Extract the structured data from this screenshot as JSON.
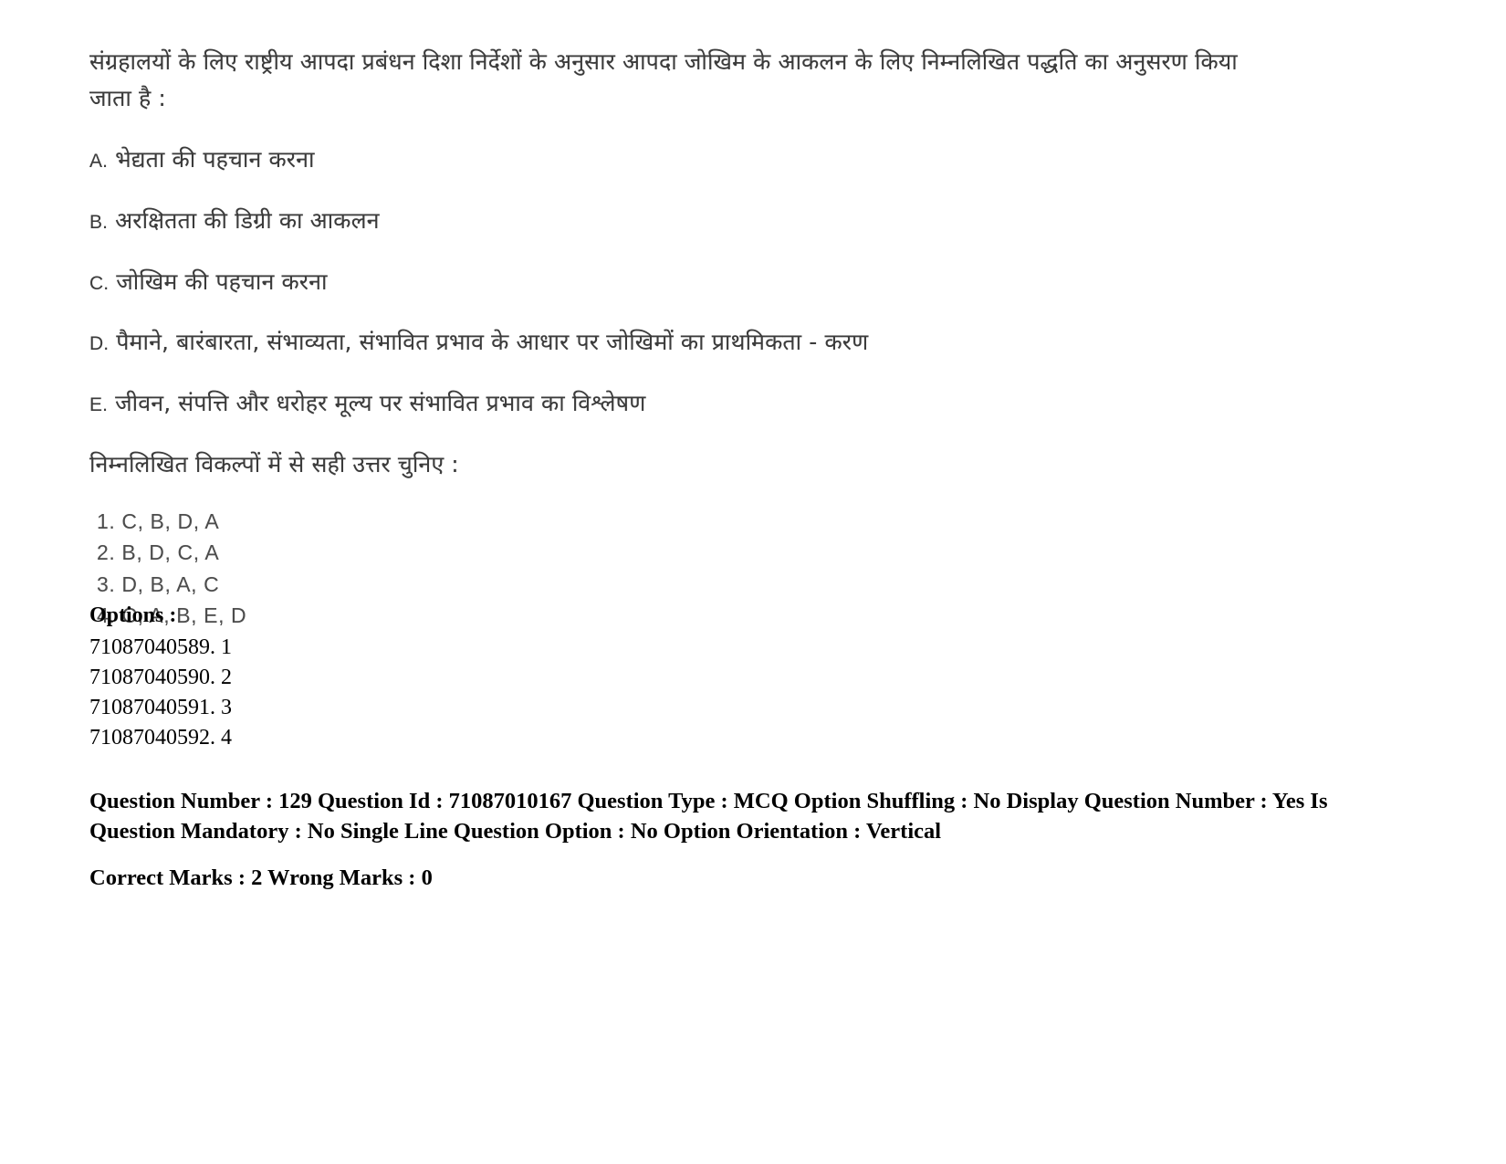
{
  "document": {
    "type": "exam-question-paper",
    "background_color": "#ffffff",
    "text_color": "#000000"
  },
  "question": {
    "stem": "संग्रहालयों के लिए राष्ट्रीय आपदा प्रबंधन दिशा निर्देशों के अनुसार आपदा जोखिम के आकलन के लिए निम्नलिखित पद्धति का अनुसरण किया जाता है :",
    "statements": [
      {
        "label": "A.",
        "text": "भेद्यता की पहचान करना"
      },
      {
        "label": "B.",
        "text": "अरक्षितता की डिग्री का आकलन"
      },
      {
        "label": "C.",
        "text": "जोखिम की पहचान करना"
      },
      {
        "label": "D.",
        "text": "पैमाने, बारंबारता, संभाव्यता, संभावित प्रभाव के आधार पर जोखिमों का प्राथमिकता - करण"
      },
      {
        "label": "E.",
        "text": "जीवन, संपत्ति और धरोहर मूल्य पर संभावित प्रभाव का विश्लेषण"
      }
    ],
    "instruction": "निम्नलिखित विकल्पों में से सही उत्तर चुनिए :",
    "choices": [
      {
        "number": "1.",
        "text": "C, B, D, A",
        "full": "1. C, B, D, A"
      },
      {
        "number": "2.",
        "text": "B, D, C, A",
        "full": "2. B, D, C, A"
      },
      {
        "number": "3.",
        "text": "D, B, A, C",
        "full": "3. D, B, A, C"
      },
      {
        "number": "4.",
        "text": "C, A, B, E, D",
        "full": "4. C, A, B, E, D"
      }
    ]
  },
  "options_section": {
    "title": "Options :",
    "rows": [
      {
        "id": "71087040589",
        "value": "1",
        "full": "71087040589. 1"
      },
      {
        "id": "71087040590",
        "value": "2",
        "full": "71087040590. 2"
      },
      {
        "id": "71087040591",
        "value": "3",
        "full": "71087040591. 3"
      },
      {
        "id": "71087040592",
        "value": "4",
        "full": "71087040592. 4"
      }
    ]
  },
  "metadata": {
    "question_number_label": "Question Number :",
    "question_number": "129",
    "question_id_label": "Question Id :",
    "question_id": "71087010167",
    "question_type_label": "Question Type :",
    "question_type": "MCQ",
    "option_shuffling_label": "Option Shuffling :",
    "option_shuffling": "No",
    "display_question_number_label": "Display Question Number :",
    "display_question_number": "Yes",
    "is_question_mandatory_label": "Is Question Mandatory :",
    "is_question_mandatory": "No",
    "single_line_question_option_label": "Single Line Question Option :",
    "single_line_question_option": "No",
    "option_orientation_label": "Option Orientation :",
    "option_orientation": "Vertical",
    "correct_marks_label": "Correct Marks :",
    "correct_marks": "2",
    "wrong_marks_label": "Wrong Marks :",
    "wrong_marks": "0",
    "line_1": "Question Number : 129 Question Id : 71087010167 Question Type : MCQ Option Shuffling : No Display Question Number : Yes Is Question Mandatory : No Single Line Question Option : No Option Orientation : Vertical",
    "line_2": "Correct Marks : 2 Wrong Marks : 0"
  }
}
